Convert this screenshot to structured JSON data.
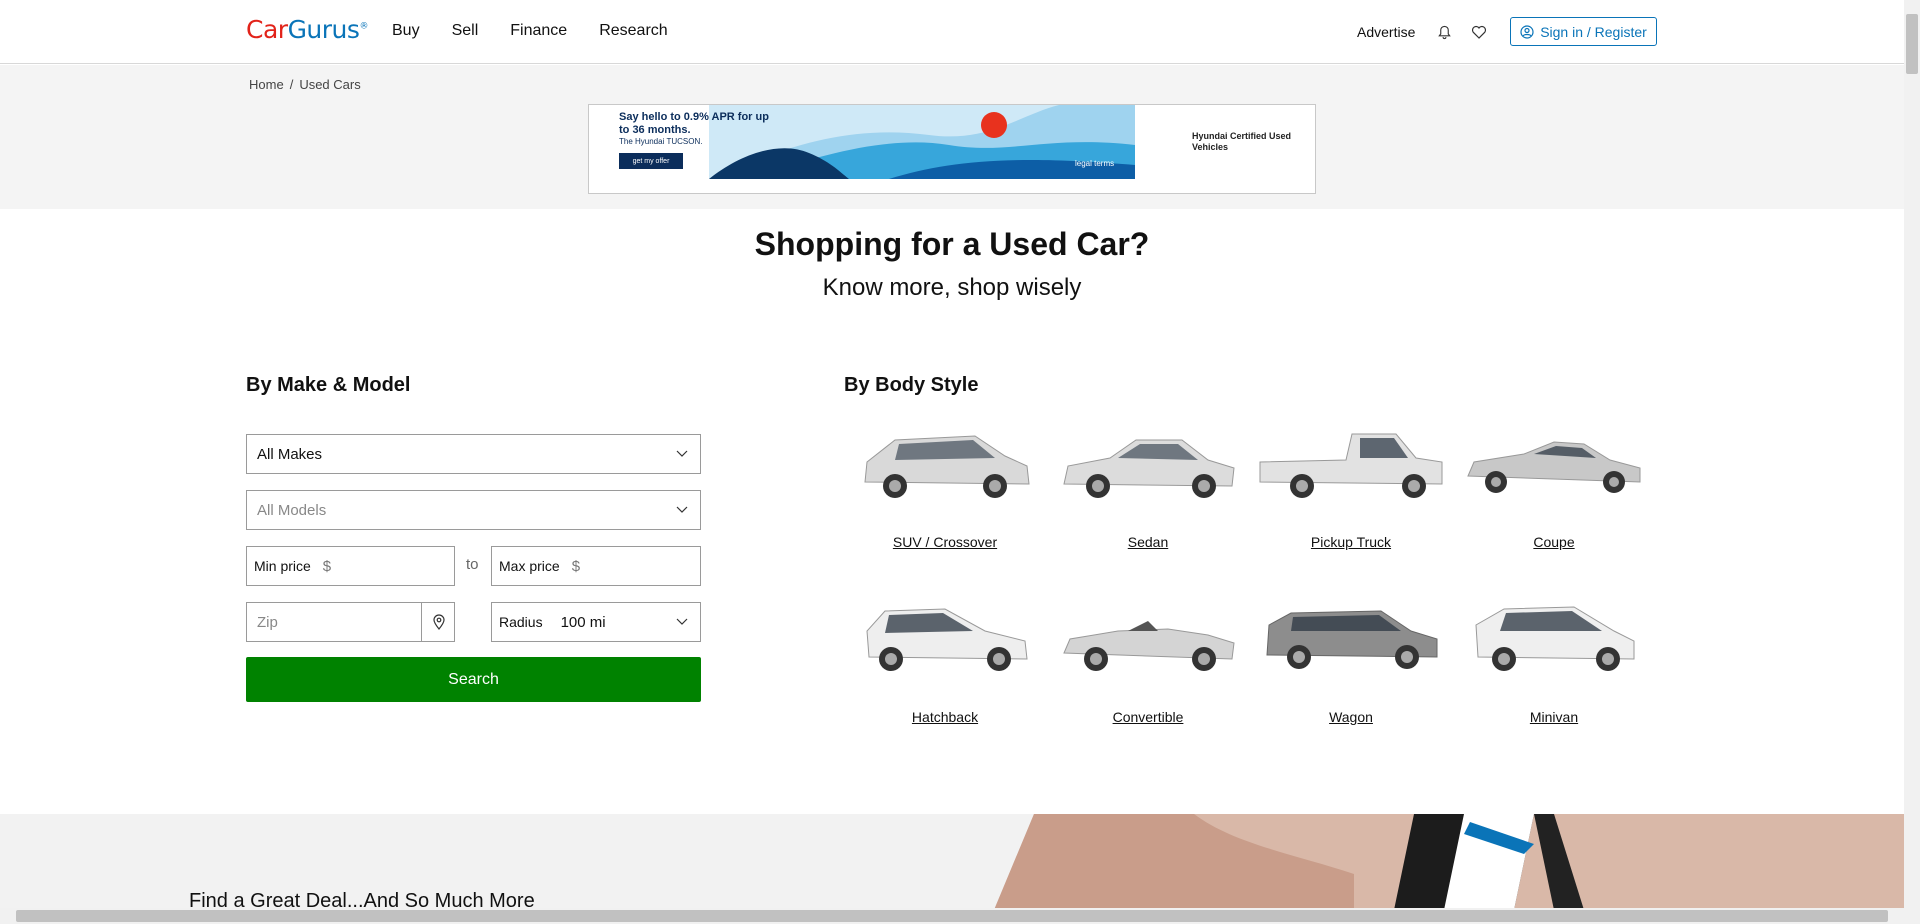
{
  "header": {
    "logo": {
      "car": "Car",
      "gurus": "Gurus",
      "mark": "®"
    },
    "nav": [
      "Buy",
      "Sell",
      "Finance",
      "Research"
    ],
    "advertise": "Advertise",
    "signin": "Sign in / Register"
  },
  "breadcrumb": {
    "home": "Home",
    "sep": "/",
    "current": "Used Cars"
  },
  "ad": {
    "headline": "Say hello to 0.9% APR for up to 36 months.",
    "subline": "The Hyundai TUCSON.",
    "button": "get my offer",
    "legal": "legal terms",
    "brand": "Hyundai Certified Used Vehicles"
  },
  "hero": {
    "title": "Shopping for a Used Car?",
    "subtitle": "Know more, shop wisely"
  },
  "make_model": {
    "title": "By Make & Model",
    "make": "All Makes",
    "model": "All Models",
    "min_price_label": "Min price",
    "max_price_label": "Max price",
    "currency": "$",
    "to": "to",
    "zip_placeholder": "Zip",
    "radius_label": "Radius",
    "radius_value": "100 mi",
    "search": "Search"
  },
  "body_style": {
    "title": "By Body Style",
    "items": [
      "SUV / Crossover",
      "Sedan",
      "Pickup Truck",
      "Coupe",
      "Hatchback",
      "Convertible",
      "Wagon",
      "Minivan"
    ]
  },
  "bottom": {
    "title": "Find a Great Deal...And So Much More"
  },
  "colors": {
    "brand_red": "#e2231a",
    "brand_blue": "#0a74b8",
    "search_green": "#008200"
  },
  "icons": [
    "bell-icon",
    "heart-icon",
    "user-circle-icon",
    "chevron-down-icon",
    "location-pin-icon"
  ]
}
